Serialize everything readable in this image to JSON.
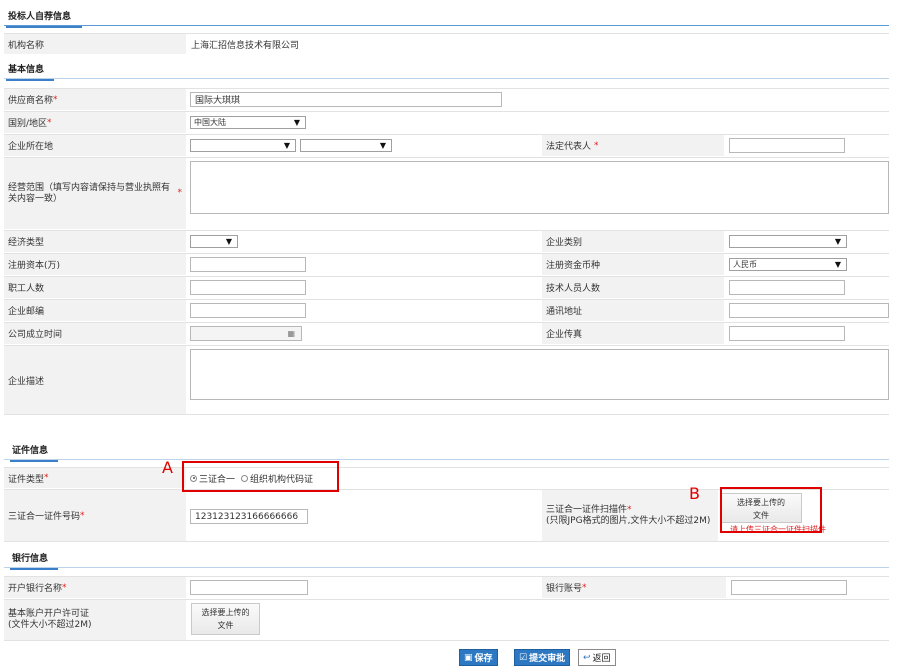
{
  "sections": {
    "bidder_info": "投标人自荐信息",
    "basic_info": "基本信息",
    "cert_info": "证件信息",
    "bank_info": "银行信息"
  },
  "bidder": {
    "org_name_label": "机构名称",
    "org_name_value": "上海汇招信息技术有限公司"
  },
  "basic": {
    "supplier_name_label": "供应商名称",
    "supplier_name_value": "国际大琪琪",
    "country_label": "国别/地区",
    "country_value": "中国大陆",
    "location_label": "企业所在地",
    "legal_rep_label": "法定代表人",
    "business_scope_label": "经营范围（填写内容请保持与营业执照有关内容一致）",
    "economic_type_label": "经济类型",
    "company_type_label": "企业类别",
    "reg_capital_label": "注册资本(万)",
    "reg_currency_label": "注册资金币种",
    "reg_currency_value": "人民币",
    "employees_label": "职工人数",
    "tech_staff_label": "技术人员人数",
    "postcode_label": "企业邮编",
    "address_label": "通讯地址",
    "founded_label": "公司成立时间",
    "fax_label": "企业传真",
    "description_label": "企业描述"
  },
  "cert": {
    "type_label": "证件类型",
    "option_a": "三证合一",
    "option_b": "组织机构代码证",
    "number_label": "三证合一证件号码",
    "number_value": "123123123166666666",
    "scan_label": "三证合一证件扫描件",
    "scan_hint": "(只限JPG格式的图片,文件大小不超过2M)",
    "upload_label_1": "选择要上传的",
    "upload_label_2": "文件",
    "upload_warning": "请上传三证合一证件扫描件",
    "annot_a": "A",
    "annot_b": "B"
  },
  "bank": {
    "bank_name_label": "开户银行名称",
    "account_label": "银行账号",
    "permit_label_1": "基本账户开户许可证",
    "permit_label_2": "(文件大小不超过2M)",
    "upload_label_1": "选择要上传的",
    "upload_label_2": "文件"
  },
  "actions": {
    "save": "保存",
    "submit": "提交审批",
    "back": "返回"
  },
  "required_mark": "*",
  "colors": {
    "accent": "#2c78c2",
    "annotation": "#e00000",
    "required": "#e02020"
  }
}
